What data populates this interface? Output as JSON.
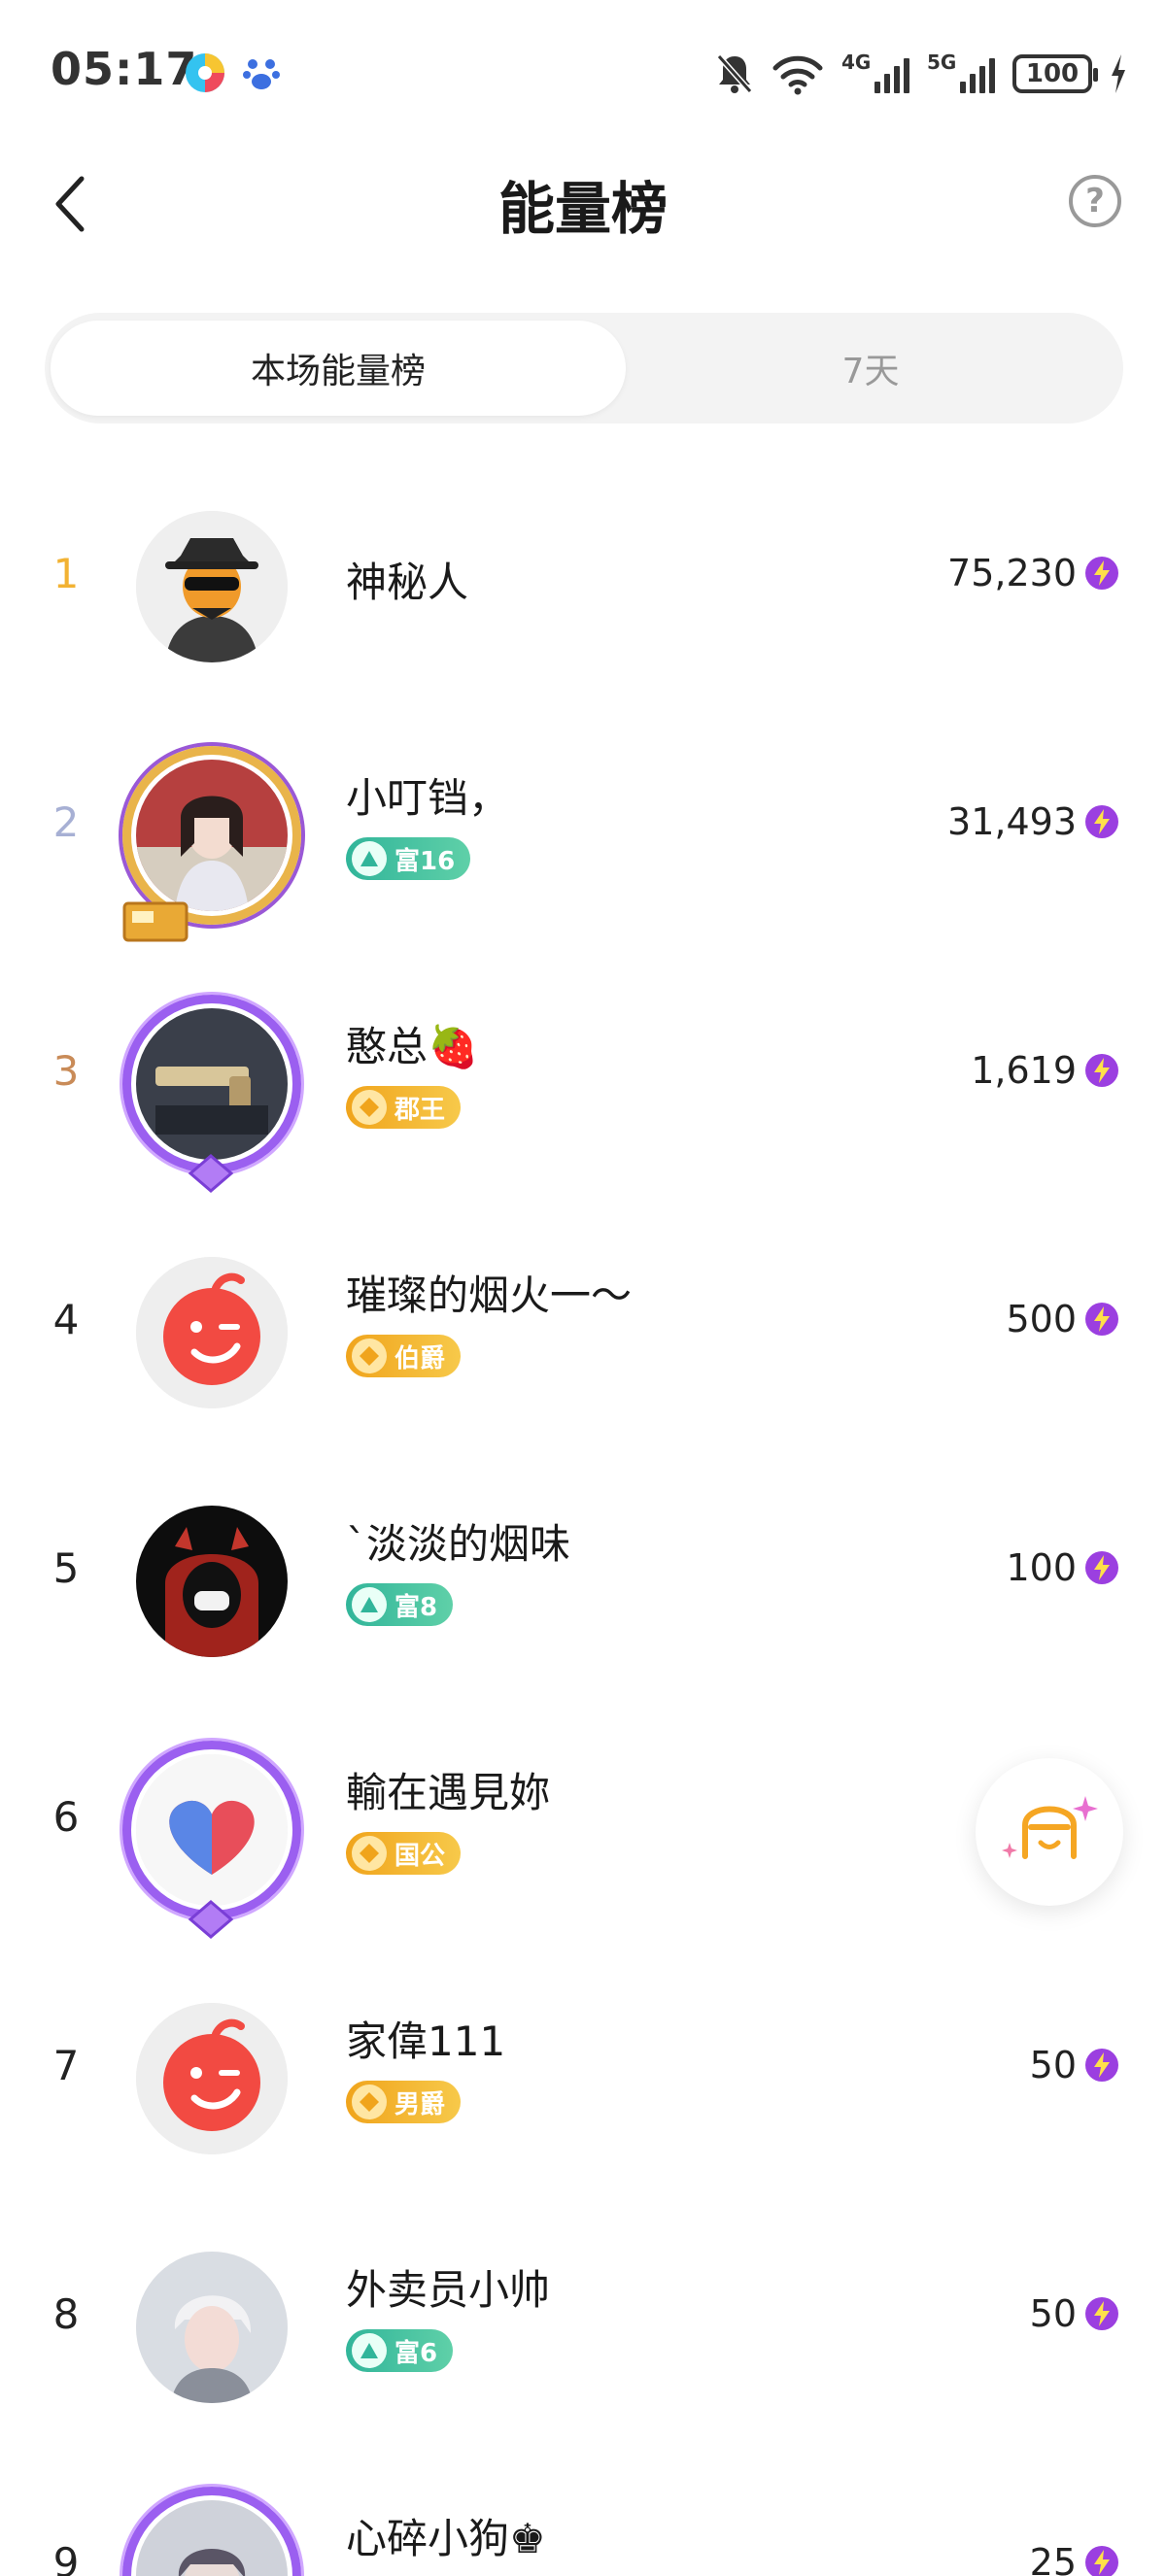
{
  "status_bar": {
    "time": "05:17",
    "signal_4g": "4G",
    "signal_5g": "5G",
    "battery": "100"
  },
  "header": {
    "title": "能量榜",
    "help_label": "?"
  },
  "tabs": [
    {
      "label": "本场能量榜",
      "active": true
    },
    {
      "label": "7天",
      "active": false
    }
  ],
  "ranking": [
    {
      "rank": "1",
      "name": "神秘人",
      "badge": "",
      "score": "75,230"
    },
    {
      "rank": "2",
      "name": "小叮铛，",
      "badge": "富16",
      "score": "31,493"
    },
    {
      "rank": "3",
      "name": "憨总🍓",
      "badge": "郡王",
      "score": "1,619"
    },
    {
      "rank": "4",
      "name": "璀璨的烟火一～",
      "badge": "伯爵",
      "score": "500"
    },
    {
      "rank": "5",
      "name": "`淡淡的烟味",
      "badge": "富8",
      "score": "100"
    },
    {
      "rank": "6",
      "name": "輸在遇見妳",
      "badge": "国公",
      "score": ""
    },
    {
      "rank": "7",
      "name": "家偉111",
      "badge": "男爵",
      "score": "50"
    },
    {
      "rank": "8",
      "name": "外卖员小帅",
      "badge": "富6",
      "score": "50"
    },
    {
      "rank": "9",
      "name": "心碎小狗♚",
      "badge": "",
      "score": "25"
    }
  ],
  "colors": {
    "rank1": "#f2b233",
    "rank2": "#a7b0d4",
    "rank3": "#c98b58",
    "energy_icon": "#9b3fe0",
    "rich_badge": "#31b59a",
    "noble_badge": "#f0a41c"
  },
  "icons": {
    "back": "chevron-left-icon",
    "help": "question-circle-icon",
    "energy": "lightning-icon"
  }
}
